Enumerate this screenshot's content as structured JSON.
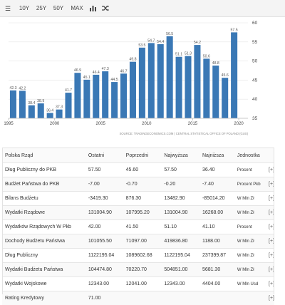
{
  "toolbar": {
    "buttons": [
      {
        "label": "",
        "icon": "table-icon"
      },
      {
        "label": "10Y"
      },
      {
        "label": "25Y"
      },
      {
        "label": "50Y"
      },
      {
        "label": "MAX"
      },
      {
        "label": "",
        "icon": "bar-chart-icon"
      },
      {
        "label": "",
        "icon": "shuffle-icon"
      }
    ]
  },
  "chart_data": {
    "type": "bar",
    "x": [
      1995,
      1996,
      1997,
      1998,
      1999,
      2000,
      2001,
      2002,
      2003,
      2004,
      2005,
      2006,
      2007,
      2008,
      2009,
      2010,
      2011,
      2012,
      2013,
      2014,
      2015,
      2016,
      2017,
      2018,
      2019,
      2020
    ],
    "values": [
      42.3,
      42.2,
      38.4,
      38.9,
      36.4,
      37.3,
      41.7,
      46.9,
      45.1,
      46.4,
      47.3,
      44.5,
      46.7,
      49.8,
      53.5,
      54.7,
      54.4,
      56.5,
      51.1,
      51.3,
      54.2,
      50.6,
      48.8,
      45.6,
      57.5
    ],
    "x_values": [
      1995.5,
      1996.5,
      1997.5,
      1998.5,
      1999.5,
      2000.5,
      2001.5,
      2002.5,
      2003.5,
      2004.5,
      2005.5,
      2006.5,
      2007.5,
      2008.5,
      2009.5,
      2010.5,
      2011.5,
      2012.5,
      2013.5,
      2014.5,
      2015.5,
      2016.5,
      2017.5,
      2018.5,
      2019.5
    ],
    "xticks": [
      1995,
      2000,
      2005,
      2010,
      2015,
      2020
    ],
    "yticks": [
      35,
      40,
      45,
      50,
      55,
      60
    ],
    "ylim": [
      35,
      60
    ],
    "xlim": [
      1995,
      2021
    ],
    "y_axis_position": "right",
    "grid": "horizontal",
    "bar_color": "#3a78b5",
    "source": "SOURCE: TRADINGECONOMICS.COM  |  CENTRAL STATISTICAL OFFICE OF POLAND (GUS)"
  },
  "table": {
    "headers": [
      "Polska Rząd",
      "Ostatni",
      "Poprzedni",
      "Najwyższa",
      "Najniższa",
      "Jednostka",
      ""
    ],
    "rows": [
      [
        "Dług Publiczny do PKB",
        "57.50",
        "45.60",
        "57.50",
        "36.40",
        "Procent",
        "[+]"
      ],
      [
        "Budżet Państwa do PKB",
        "-7.00",
        "-0.70",
        "-0.20",
        "-7.40",
        "Procent Pkb",
        "[+]"
      ],
      [
        "Bilans Budżetu",
        "-3419.30",
        "876.30",
        "13482.90",
        "-85014.20",
        "W Mln Zł",
        "[+]"
      ],
      [
        "Wydatki Rządowe",
        "131004.90",
        "107995.20",
        "131004.90",
        "16268.00",
        "W Mln Zł",
        "[+]"
      ],
      [
        "Wydatków Rządowych W Pkb",
        "42.00",
        "41.50",
        "51.10",
        "41.10",
        "Procent",
        "[+]"
      ],
      [
        "Dochody Budżetu Państwa",
        "101055.50",
        "71097.00",
        "419836.80",
        "1188.00",
        "W Mln Zł",
        "[+]"
      ],
      [
        "Dług Publiczny",
        "1122195.04",
        "1089602.68",
        "1122195.04",
        "237399.87",
        "W Mln Zł",
        "[+]"
      ],
      [
        "Wydatki Budżetu Państwa",
        "104474.80",
        "70220.70",
        "504851.00",
        "5681.30",
        "W Mln Zł",
        "[+]"
      ],
      [
        "Wydatki Wojskowe",
        "12343.00",
        "12041.00",
        "12343.00",
        "4404.00",
        "W Mln Usd",
        "[+]"
      ],
      [
        "Rating Kredytowy",
        "71.00",
        "",
        "",
        "",
        "",
        "[+]"
      ]
    ]
  }
}
